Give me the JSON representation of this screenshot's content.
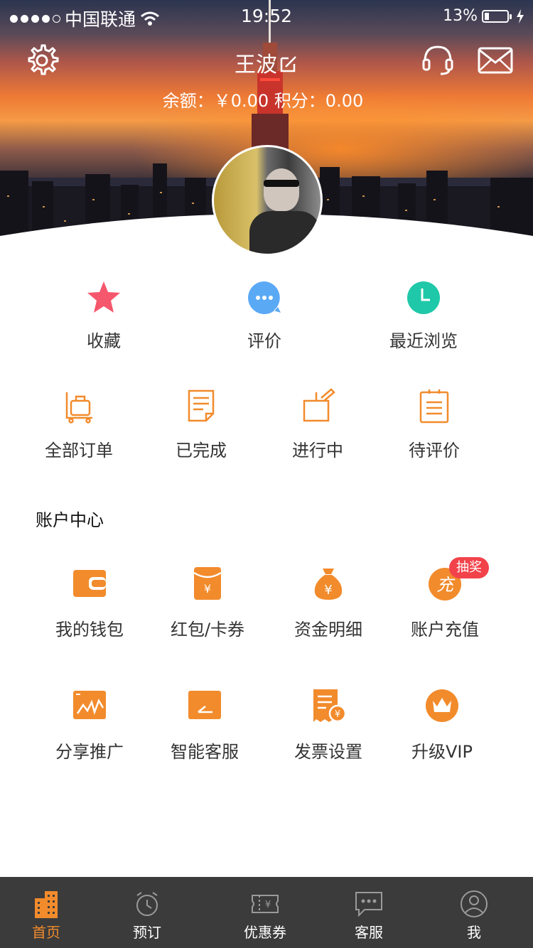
{
  "status_bar": {
    "carrier": "中国联通",
    "time": "19:52",
    "battery": "13%"
  },
  "header": {
    "name": "王波",
    "balance_label": "余额：￥0.00",
    "points_label": "积分：0.00"
  },
  "quick_links": [
    {
      "label": "收藏",
      "icon": "star-icon"
    },
    {
      "label": "评价",
      "icon": "chat-bubble-icon"
    },
    {
      "label": "最近浏览",
      "icon": "clock-icon"
    }
  ],
  "orders": [
    {
      "label": "全部订单",
      "icon": "luggage-cart-icon"
    },
    {
      "label": "已完成",
      "icon": "document-icon"
    },
    {
      "label": "进行中",
      "icon": "box-pen-icon"
    },
    {
      "label": "待评价",
      "icon": "clipboard-icon"
    }
  ],
  "account": {
    "title": "账户中心",
    "items": [
      {
        "label": "我的钱包",
        "icon": "wallet-icon"
      },
      {
        "label": "红包/卡券",
        "icon": "red-packet-icon"
      },
      {
        "label": "资金明细",
        "icon": "money-bag-icon"
      },
      {
        "label": "账户充值",
        "icon": "recharge-icon",
        "badge": "抽奖",
        "glyph": "充"
      },
      {
        "label": "分享推广",
        "icon": "share-chart-icon"
      },
      {
        "label": "智能客服",
        "icon": "smart-service-icon"
      },
      {
        "label": "发票设置",
        "icon": "invoice-icon"
      },
      {
        "label": "升级VIP",
        "icon": "crown-icon"
      }
    ]
  },
  "tabbar": [
    {
      "label": "首页",
      "icon": "building-icon",
      "active": true
    },
    {
      "label": "预订",
      "icon": "alarm-clock-icon"
    },
    {
      "label": "优惠券",
      "icon": "ticket-icon"
    },
    {
      "label": "客服",
      "icon": "message-icon"
    },
    {
      "label": "我",
      "icon": "user-icon"
    }
  ],
  "colors": {
    "accent": "#F28B2C",
    "star": "#F5576C",
    "chat": "#5AA9F5",
    "clock": "#1FC8A8",
    "badge": "#F2424A",
    "tabbar": "#3B3B3B"
  }
}
